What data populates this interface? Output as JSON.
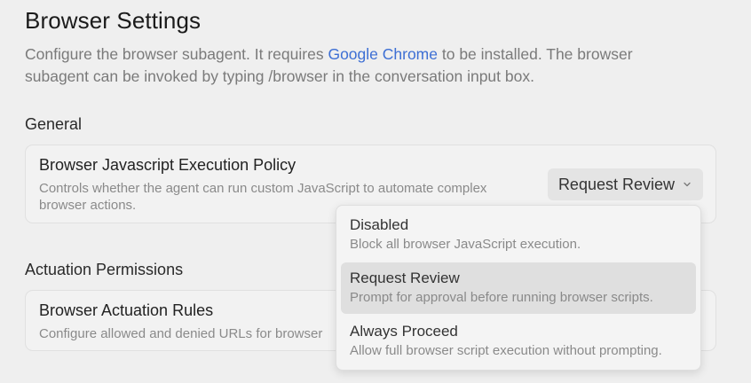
{
  "header": {
    "title": "Browser Settings",
    "desc_before": "Configure the browser subagent. It requires ",
    "desc_link": "Google Chrome",
    "desc_after": " to be installed. The browser subagent can be invoked by typing /browser in the conversation input box."
  },
  "general": {
    "label": "General",
    "policy": {
      "title": "Browser Javascript Execution Policy",
      "desc": "Controls whether the agent can run custom JavaScript to automate complex browser actions.",
      "selected": "Request Review"
    }
  },
  "actuation": {
    "label": "Actuation Permissions",
    "rules": {
      "title": "Browser Actuation Rules",
      "desc": "Configure allowed and denied URLs for browser"
    }
  },
  "dropdown": {
    "options": [
      {
        "label": "Disabled",
        "desc": "Block all browser JavaScript execution.",
        "selected": false
      },
      {
        "label": "Request Review",
        "desc": "Prompt for approval before running browser scripts.",
        "selected": true
      },
      {
        "label": "Always Proceed",
        "desc": "Allow full browser script execution without prompting.",
        "selected": false
      }
    ]
  },
  "colors": {
    "link": "#3d6fd4",
    "background": "#efefef",
    "selected_option": "#dfdfdf"
  }
}
